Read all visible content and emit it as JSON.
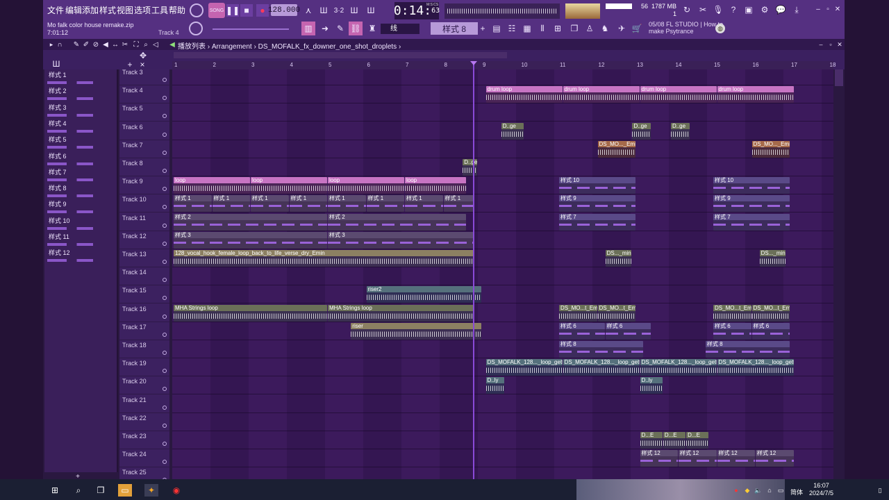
{
  "menu": [
    "文件",
    "编辑",
    "添加",
    "样式",
    "视图",
    "选项",
    "工具",
    "帮助"
  ],
  "transport": {
    "mode_label": "SONG",
    "tempo": "128.000",
    "clock_main": "0:14",
    "clock_sub": "63",
    "clock_unit": "M:S:CS"
  },
  "project": {
    "filename": "Mo falk color house remake.zip",
    "time": "7:01:12",
    "track_hint": "Track 4"
  },
  "monitor": {
    "memory": "1787 MB",
    "cpu": "56",
    "voices": "1"
  },
  "toolbar": {
    "snap": "线",
    "pattern": "样式 8"
  },
  "news": {
    "date": "05/08",
    "source": "FL STUDIO",
    "text": "| How to make Psytrance"
  },
  "playlist": {
    "title": "播放列表",
    "crumbs": [
      "Arrangement",
      "DS_MOFALK_fx_downer_one_shot_droplets"
    ]
  },
  "ruler": [
    "1",
    "2",
    "3",
    "4",
    "5",
    "6",
    "7",
    "8",
    "9",
    "10",
    "11",
    "12",
    "13",
    "14",
    "15",
    "16",
    "17",
    "18"
  ],
  "patterns": [
    "样式 1",
    "样式 2",
    "样式 3",
    "样式 4",
    "样式 5",
    "样式 6",
    "样式 7",
    "样式 8",
    "样式 9",
    "样式 10",
    "样式 11",
    "样式 12"
  ],
  "tracks": [
    "Track 3",
    "Track 4",
    "Track 5",
    "Track 6",
    "Track 7",
    "Track 8",
    "Track 9",
    "Track 10",
    "Track 11",
    "Track 12",
    "Track 13",
    "Track 14",
    "Track 15",
    "Track 16",
    "Track 17",
    "Track 18",
    "Track 19",
    "Track 20",
    "Track 21",
    "Track 22",
    "Track 23",
    "Track 24",
    "Track 25"
  ],
  "clips": {
    "drum": "drum loop",
    "loop": "loop",
    "p1": "样式 1",
    "p2": "样式 2",
    "p3": "样式 3",
    "p6": "样式 6",
    "p7": "样式 7",
    "p8": "样式 8",
    "p9": "样式 9",
    "p10": "样式 10",
    "p12": "样式 12",
    "vocal": "128_vocal_hook_female_loop_back_to_life_verse_dry_Emin",
    "riser2": "riser2",
    "riser": "riser",
    "strings": "MHA Strings loop",
    "ds_emin": "DS_MO..._Emin",
    "ds_min": "DS..._min",
    "ds_temin": "DS_MO...t_Emin",
    "ds_long": "DS_MOFALK_128..._loop_gettem",
    "dge": "D..ge",
    "dly": "D..ly",
    "de": "D...E"
  },
  "taskbar": {
    "time": "16:07",
    "date": "2024/7/5",
    "lang": "简体"
  }
}
